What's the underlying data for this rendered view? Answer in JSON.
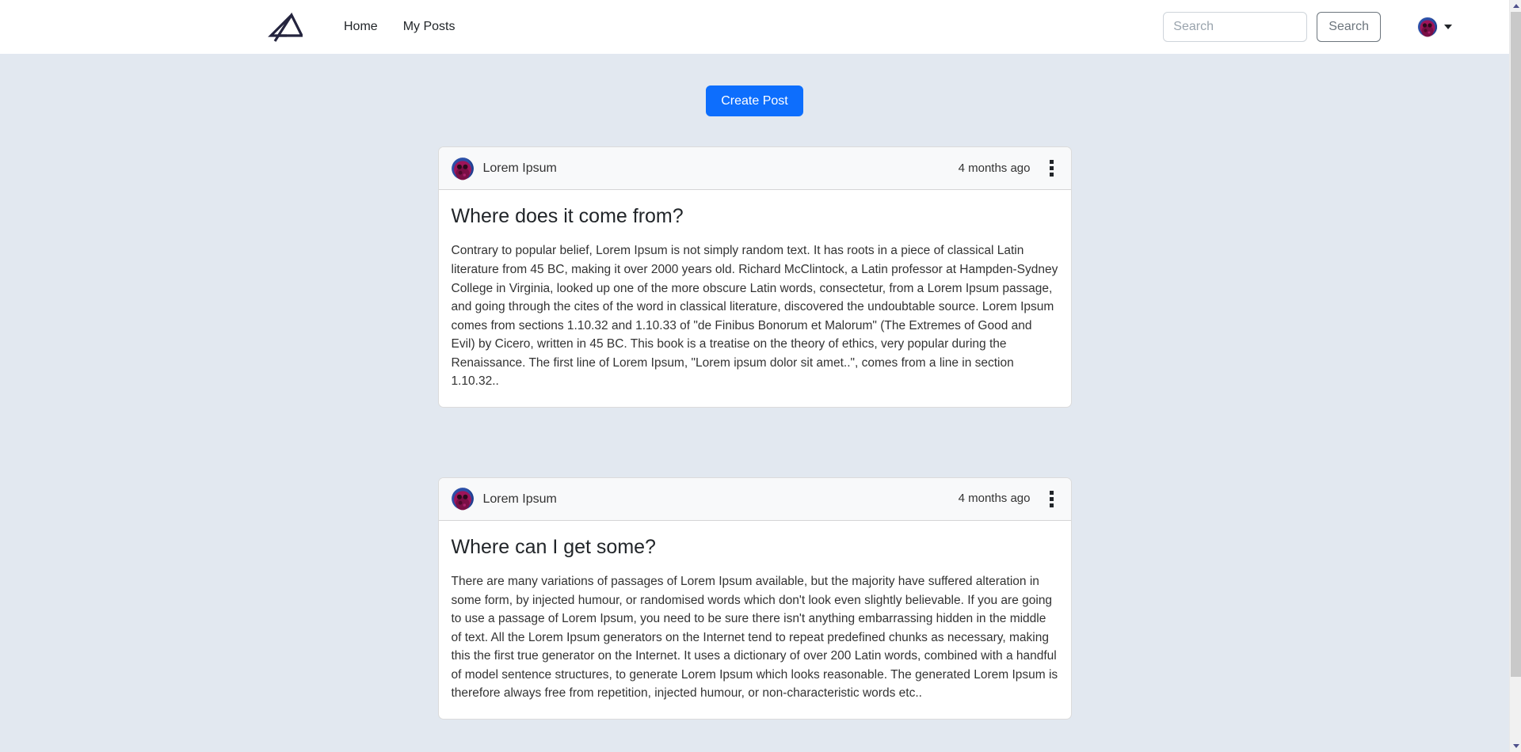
{
  "navbar": {
    "brand_icon": "angular-a-logo",
    "links": [
      {
        "label": "Home",
        "name": "home"
      },
      {
        "label": "My Posts",
        "name": "my-posts"
      }
    ],
    "search": {
      "placeholder": "Search",
      "value": "",
      "button_label": "Search"
    },
    "account": {
      "avatar_icon": "user-identicon-avatar",
      "caret_icon": "caret-down-icon"
    }
  },
  "main": {
    "create_post_label": "Create Post",
    "posts": [
      {
        "author": "Lorem Ipsum",
        "avatar_icon": "user-identicon-avatar",
        "timestamp": "4 months ago",
        "menu_icon": "kebab-menu-icon",
        "title": "Where does it come from?",
        "body": "Contrary to popular belief, Lorem Ipsum is not simply random text. It has roots in a piece of classical Latin literature from 45 BC, making it over 2000 years old. Richard McClintock, a Latin professor at Hampden-Sydney College in Virginia, looked up one of the more obscure Latin words, consectetur, from a Lorem Ipsum passage, and going through the cites of the word in classical literature, discovered the undoubtable source. Lorem Ipsum comes from sections 1.10.32 and 1.10.33 of \"de Finibus Bonorum et Malorum\" (The Extremes of Good and Evil) by Cicero, written in 45 BC. This book is a treatise on the theory of ethics, very popular during the Renaissance. The first line of Lorem Ipsum, \"Lorem ipsum dolor sit amet..\", comes from a line in section 1.10.32.."
      },
      {
        "author": "Lorem Ipsum",
        "avatar_icon": "user-identicon-avatar",
        "timestamp": "4 months ago",
        "menu_icon": "kebab-menu-icon",
        "title": "Where can I get some?",
        "body": "There are many variations of passages of Lorem Ipsum available, but the majority have suffered alteration in some form, by injected humour, or randomised words which don't look even slightly believable. If you are going to use a passage of Lorem Ipsum, you need to be sure there isn't anything embarrassing hidden in the middle of text. All the Lorem Ipsum generators on the Internet tend to repeat predefined chunks as necessary, making this the first true generator on the Internet. It uses a dictionary of over 200 Latin words, combined with a handful of model sentence structures, to generate Lorem Ipsum which looks reasonable. The generated Lorem Ipsum is therefore always free from repetition, injected humour, or non-characteristic words etc.."
      }
    ]
  },
  "scrollbar": {
    "up_icon": "scroll-up-arrow-icon",
    "down_icon": "scroll-down-arrow-icon"
  },
  "colors": {
    "accent": "#0d6efd",
    "page_bg": "#e2e8f0",
    "card_bg": "#ffffff",
    "card_header_bg": "#f8f9fa",
    "navbar_bg": "#ffffff",
    "text": "#212529",
    "muted_text": "#6c757d"
  }
}
